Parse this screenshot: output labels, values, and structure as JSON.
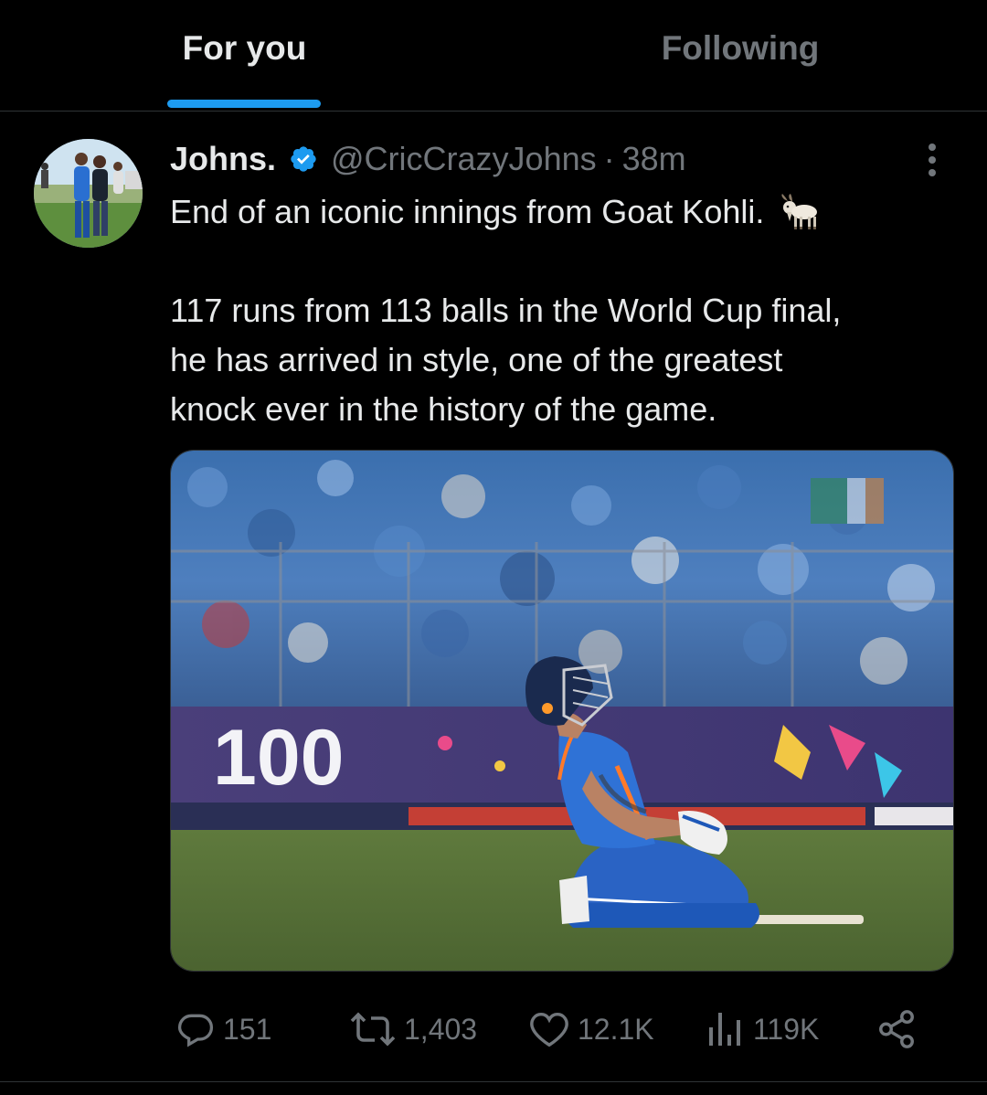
{
  "tabs": [
    {
      "label": "For you",
      "active": true
    },
    {
      "label": "Following",
      "active": false
    }
  ],
  "tweet": {
    "author_name": "Johns.",
    "verified": true,
    "handle": "@CricCrazyJohns",
    "separator": "·",
    "time": "38m",
    "text_line1": "End of an iconic innings from Goat Kohli.",
    "emoji": "goat-emoji",
    "text_line2": "117 runs from 113 balls in the World Cup final,",
    "text_line3": "he has arrived in style, one of the greatest",
    "text_line4": "knock ever in the history of the game.",
    "media_banner_text": "100",
    "stats": {
      "replies": "151",
      "retweets": "1,403",
      "likes": "12.1K",
      "views": "119K"
    }
  },
  "colors": {
    "background": "#000000",
    "accent": "#1d9bf0",
    "text_primary": "#e7e9ea",
    "text_secondary": "#71767b",
    "divider": "#2f3336"
  },
  "icons": {
    "reply": "speech-bubble-icon",
    "retweet": "retweet-icon",
    "like": "heart-icon",
    "views": "bar-chart-icon",
    "share": "share-icon",
    "more": "more-vertical-icon",
    "verified": "verified-badge-icon"
  }
}
